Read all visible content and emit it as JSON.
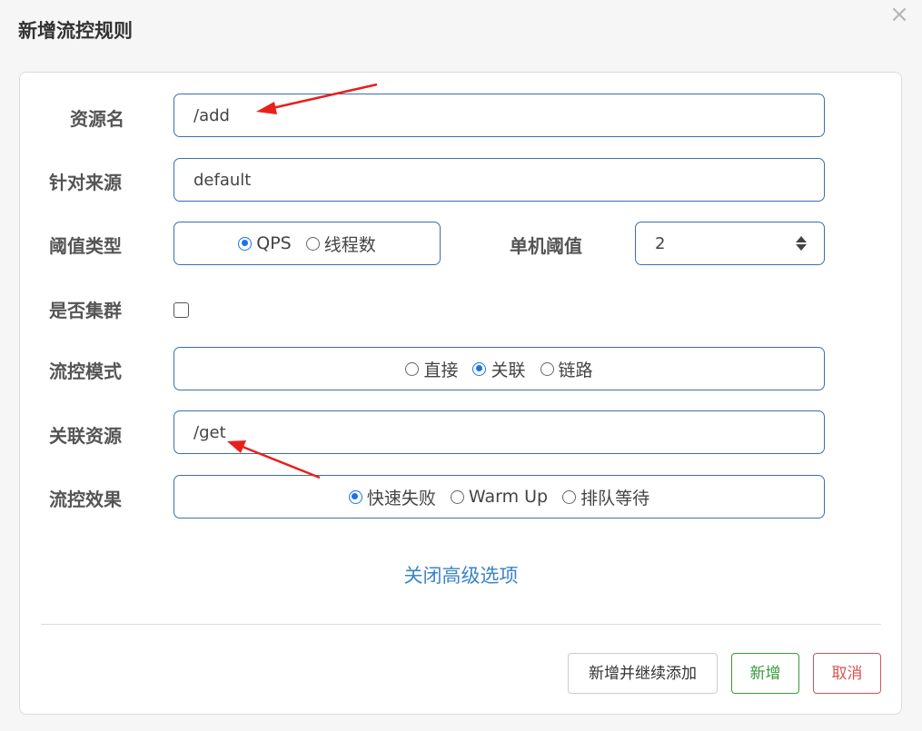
{
  "dialog": {
    "title": "新增流控规则",
    "close_icon": "close-icon"
  },
  "form": {
    "resource_name": {
      "label": "资源名",
      "value": "/add"
    },
    "limit_app": {
      "label": "针对来源",
      "value": "default"
    },
    "threshold_type": {
      "label": "阈值类型",
      "options": [
        "QPS",
        "线程数"
      ],
      "selected": "QPS"
    },
    "single_threshold": {
      "label": "单机阈值",
      "value": "2"
    },
    "cluster": {
      "label": "是否集群",
      "checked": false
    },
    "flow_mode": {
      "label": "流控模式",
      "options": [
        "直接",
        "关联",
        "链路"
      ],
      "selected": "关联"
    },
    "ref_resource": {
      "label": "关联资源",
      "value": "/get"
    },
    "control_effect": {
      "label": "流控效果",
      "options": [
        "快速失败",
        "Warm Up",
        "排队等待"
      ],
      "selected": "快速失败"
    },
    "advanced_toggle": "关闭高级选项"
  },
  "footer": {
    "add_continue_label": "新增并继续添加",
    "add_label": "新增",
    "cancel_label": "取消"
  },
  "colors": {
    "accent": "#1a73e8",
    "input_border": "#3d6ea8",
    "link": "#3b83c6",
    "success": "#3a9a3a",
    "danger": "#d9534f",
    "annotation_arrow": "#e8201c"
  }
}
